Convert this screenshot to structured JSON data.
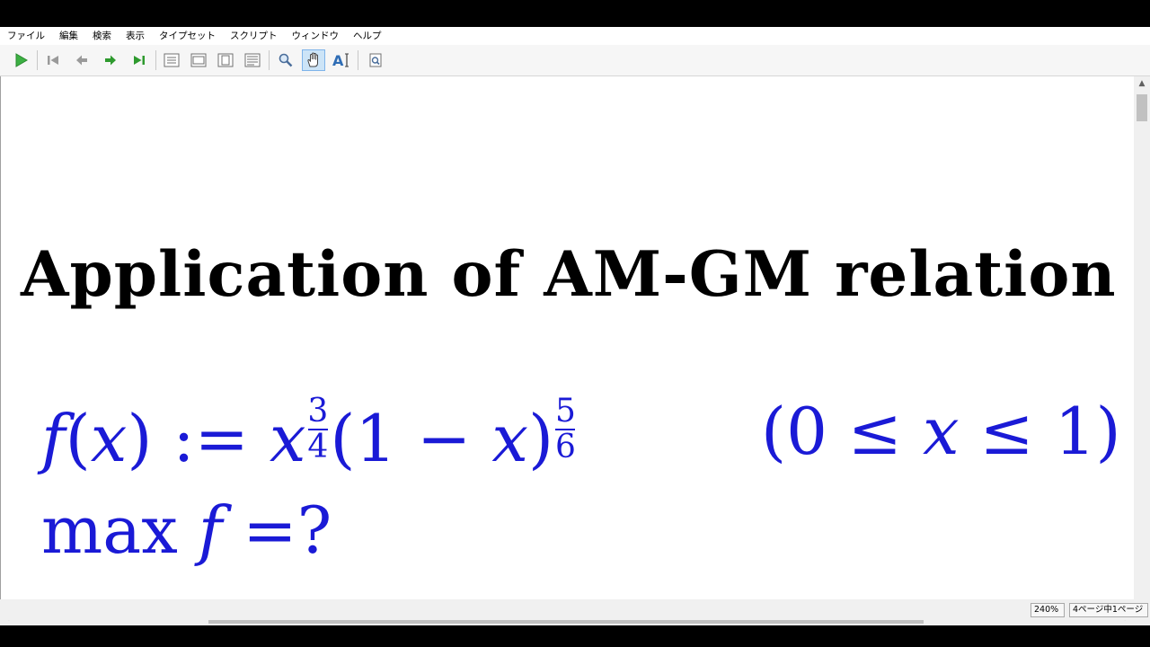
{
  "menu": [
    {
      "label": "ファイル"
    },
    {
      "label": "編集"
    },
    {
      "label": "検索"
    },
    {
      "label": "表示"
    },
    {
      "label": "タイプセット"
    },
    {
      "label": "スクリプト"
    },
    {
      "label": "ウィンドウ"
    },
    {
      "label": "ヘルプ"
    }
  ],
  "toolbar": {
    "buttons": [
      {
        "name": "typeset-button",
        "icon": "play-icon"
      },
      {
        "name": "first-page-button",
        "icon": "first-page-icon"
      },
      {
        "name": "previous-page-button",
        "icon": "arrow-left-icon"
      },
      {
        "name": "next-page-button",
        "icon": "arrow-right-icon"
      },
      {
        "name": "last-page-button",
        "icon": "last-page-icon"
      },
      {
        "name": "actual-size-button",
        "icon": "page-actual-size-icon"
      },
      {
        "name": "fit-width-button",
        "icon": "page-fit-width-icon"
      },
      {
        "name": "fit-window-button",
        "icon": "page-fit-window-icon"
      },
      {
        "name": "fit-content-button",
        "icon": "page-fit-content-icon"
      },
      {
        "name": "magnify-button",
        "icon": "magnifier-icon"
      },
      {
        "name": "scroll-hand-button",
        "icon": "hand-icon",
        "active": true
      },
      {
        "name": "select-text-button",
        "icon": "text-select-icon"
      },
      {
        "name": "find-in-pdf-button",
        "icon": "find-page-icon"
      }
    ]
  },
  "document": {
    "title": "Application of AM-GM relation",
    "math_color": "#1a1ad6",
    "equation1": {
      "f": "f",
      "open_paren": "(",
      "x": "x",
      "close_assign": ") := ",
      "x2": "x",
      "exp1_num": "3",
      "exp1_den": "4",
      "mid": "(1 − ",
      "x3": "x",
      "close": ")",
      "exp2_num": "5",
      "exp2_den": "6"
    },
    "domain": {
      "open": "(0 ≤ ",
      "x": "x",
      "close": " ≤ 1)"
    },
    "equation2": {
      "max": "max ",
      "f": "f",
      "rest": " =?"
    }
  },
  "status": {
    "zoom": "240%",
    "page": "4ページ中1ページ"
  },
  "scroll": {
    "vertical_position": 0.0,
    "horizontal_thumb_fraction": 0.65
  }
}
